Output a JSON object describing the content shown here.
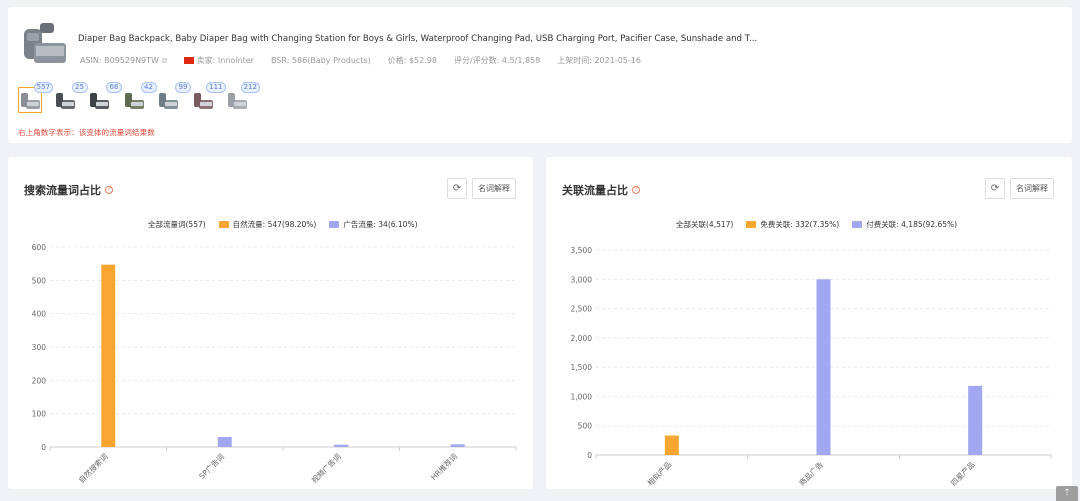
{
  "product": {
    "title": "Diaper Bag Backpack, Baby Diaper Bag with Changing Station for Boys & Girls, Waterproof Changing Pad, USB Charging Port, Pacifier Case, Sunshade and T...",
    "asin": "ASIN: B09529N9TW",
    "seller": "卖家: Innointer",
    "bsr": "BSR: 586(Baby Products)",
    "price": "价格: $52.98",
    "rating": "评分/评分数: 4.5/1,858",
    "launch": "上架时间: 2021-05-16",
    "variants": [
      {
        "count": "557",
        "color": "#8a8f96"
      },
      {
        "count": "25",
        "color": "#4a4f55"
      },
      {
        "count": "66",
        "color": "#3c4148"
      },
      {
        "count": "42",
        "color": "#5f6b4f"
      },
      {
        "count": "99",
        "color": "#6f7d88"
      },
      {
        "count": "111",
        "color": "#7a5b5e"
      },
      {
        "count": "212",
        "color": "#9aa0a6"
      }
    ],
    "variant_note": "右上角数字表示：该变体的流量词结果数"
  },
  "panels": {
    "left": {
      "title": "搜索流量词占比",
      "term_button": "名词解释",
      "legend_total": "全部流量词(557)",
      "legend": [
        "自然流量: 547(98.20%)",
        "广告流量: 34(6.10%)"
      ]
    },
    "right": {
      "title": "关联流量占比",
      "term_button": "名词解释",
      "legend_total": "全部关联(4,517)",
      "legend": [
        "免费关联: 332(7.35%)",
        "付费关联: 4,185(92.65%)"
      ]
    }
  },
  "colors": {
    "orange": "#f8a630",
    "purple": "#a1a7f0",
    "grid": "#e8e8e8",
    "axis": "#ccc"
  },
  "chart_data": [
    {
      "type": "bar",
      "categories": [
        "自然搜索词",
        "SP广告词",
        "视频广告词",
        "HR推荐词"
      ],
      "series": [
        {
          "name": "自然流量",
          "values": [
            547,
            0,
            0,
            0
          ]
        },
        {
          "name": "广告流量",
          "values": [
            0,
            30,
            7,
            8
          ]
        }
      ],
      "yticks": [
        "0",
        "100",
        "200",
        "300",
        "400",
        "500",
        "600"
      ],
      "ylim": [
        0,
        600
      ]
    },
    {
      "type": "bar",
      "categories": [
        "相似产品",
        "商品广告",
        "四星产品"
      ],
      "series": [
        {
          "name": "免费关联",
          "values": [
            332,
            0,
            0
          ]
        },
        {
          "name": "付费关联",
          "values": [
            0,
            3000,
            1180
          ]
        }
      ],
      "yticks": [
        "0",
        "500",
        "1,000",
        "1,500",
        "2,000",
        "2,500",
        "3,000",
        "3,500"
      ],
      "ylim": [
        0,
        3500
      ]
    }
  ]
}
